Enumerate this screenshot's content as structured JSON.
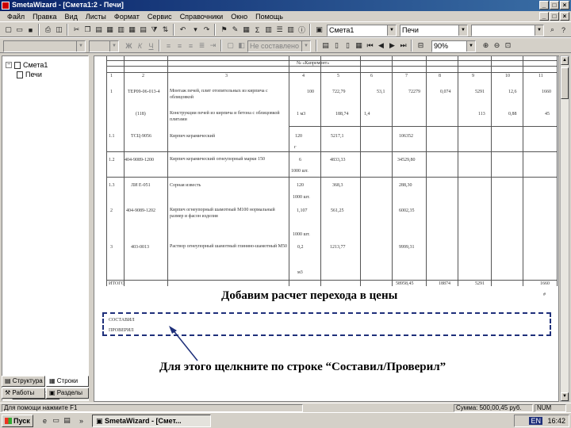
{
  "window": {
    "title": "SmetaWizard - [Смета1:2 - Печи]",
    "controls": [
      "_",
      "□",
      "×"
    ]
  },
  "menu": [
    "Файл",
    "Правка",
    "Вид",
    "Листы",
    "Формат",
    "Сервис",
    "Справочники",
    "Окно",
    "Помощь"
  ],
  "toolbar": {
    "smeta_combo": "Смета1",
    "section_combo": "Печи",
    "zoom_combo": "90%",
    "style_combo": "Не составлено в ..."
  },
  "tree": {
    "root": "Смета1",
    "child": "Печи"
  },
  "left_tabs": [
    "Структура",
    "Строки",
    "Работы",
    "Разделы"
  ],
  "document": {
    "header_label": "№ «Капремонт»",
    "col_numbers": [
      "1",
      "2",
      "3",
      "4",
      "5",
      "6",
      "7",
      "8",
      "9",
      "10",
      "11"
    ],
    "rows": [
      {
        "n": "1",
        "code": "ТЕР09-06-013-4",
        "desc": "Монтаж печей, плит отопительных из кирпича с облицовкой",
        "qty": "100",
        "price": "722,79",
        "a": "53,1",
        "b": "72279",
        "c": "0,074",
        "d": "5291",
        "e": "12,6",
        "f": "1660"
      },
      {
        "n": "",
        "code": "(118)",
        "desc": "Конструкции печей из кирпича и бетона с облицовкой плитами",
        "qty": "1 м3",
        "price": "188,74",
        "a": "1,4",
        "b": "",
        "c": "",
        "d": "113",
        "e": "0,88",
        "f": "45"
      },
      {
        "n": "1.1",
        "code": "ТСЦ-9056",
        "desc": "Кирпич керамический",
        "qty": "120",
        "price": "5217,1",
        "a": "",
        "b": "106352",
        "c": "",
        "d": "",
        "e": "",
        "f": ""
      },
      {
        "n": "1.2",
        "code": "404-9089-1200",
        "desc": "Кирпич керамический огнеупорный марки 150",
        "qty": "6",
        "price": "4833,33",
        "a": "",
        "b": "34529,80",
        "c": "",
        "d": "",
        "e": "",
        "f": ""
      },
      {
        "n": "1.3",
        "code": "ЛИ Е-051",
        "desc": "Сорная известь",
        "qty": "120",
        "price": "368,3",
        "a": "",
        "b": "288,30",
        "c": "",
        "d": "",
        "e": "",
        "f": ""
      },
      {
        "n": "2",
        "code": "404-9089-1202",
        "desc": "Кирпич огнеупорный шамотный М100 нормальный размер и фасон изделия",
        "qty": "1,107",
        "price": "561,25",
        "a": "",
        "b": "6002,35",
        "c": "",
        "d": "",
        "e": "",
        "f": ""
      },
      {
        "n": "3",
        "code": "403-0013",
        "desc": "Раствор огнеупорный шамотный глиняно-шамотный М50",
        "qty": "0,2",
        "price": "1213,77",
        "a": "",
        "b": "9999,31",
        "c": "",
        "d": "",
        "e": "",
        "f": ""
      }
    ],
    "units": [
      "1000 шт.",
      "1000 шт.",
      "1000 шт.",
      "м3"
    ],
    "total_label": "ИТОГО",
    "totals": [
      "58958,45",
      "18874",
      "5291",
      "1660"
    ],
    "hash": "#",
    "signature_lines": [
      "СОСТАВИЛ",
      "ПРОВЕРИЛ"
    ]
  },
  "overlays": {
    "top": "Добавим расчет перехода в цены",
    "bottom": "Для этого щелкните по строке “Составил/Проверил”"
  },
  "statusbar": {
    "hint": "Для помощи нажмите F1",
    "sum": "Сумма: 500,00,45 руб.",
    "mode": "NUM"
  },
  "taskbar": {
    "start": "Пуск",
    "task": "SmetaWizard - [Смет...",
    "clock": "16:42",
    "lang": "EN"
  }
}
